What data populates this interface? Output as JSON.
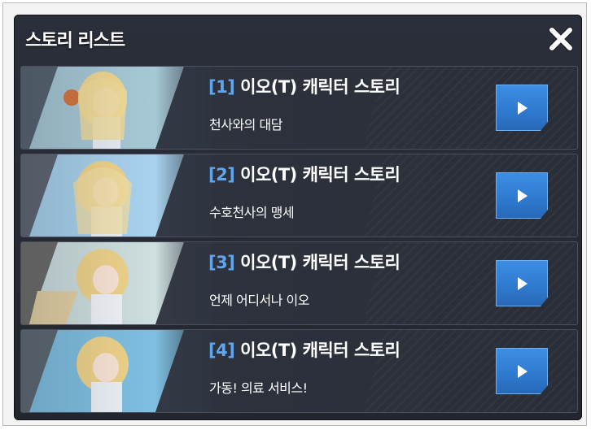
{
  "dialog": {
    "title": "스토리 리스트"
  },
  "stories": [
    {
      "number": "[1]",
      "title": "이오(T) 캐릭터 스토리",
      "subtitle": "천사와의 대담"
    },
    {
      "number": "[2]",
      "title": "이오(T) 캐릭터 스토리",
      "subtitle": "수호천사의 맹세"
    },
    {
      "number": "[3]",
      "title": "이오(T) 캐릭터 스토리",
      "subtitle": "언제 어디서나 이오"
    },
    {
      "number": "[4]",
      "title": "이오(T) 캐릭터 스토리",
      "subtitle": "가동! 의료 서비스!"
    }
  ],
  "icons": {
    "close": "close-icon",
    "play": "play-icon"
  },
  "colors": {
    "number_accent": "#5fa6ee",
    "play_button": "#2f7bd0",
    "dialog_bg": "#262a34"
  }
}
